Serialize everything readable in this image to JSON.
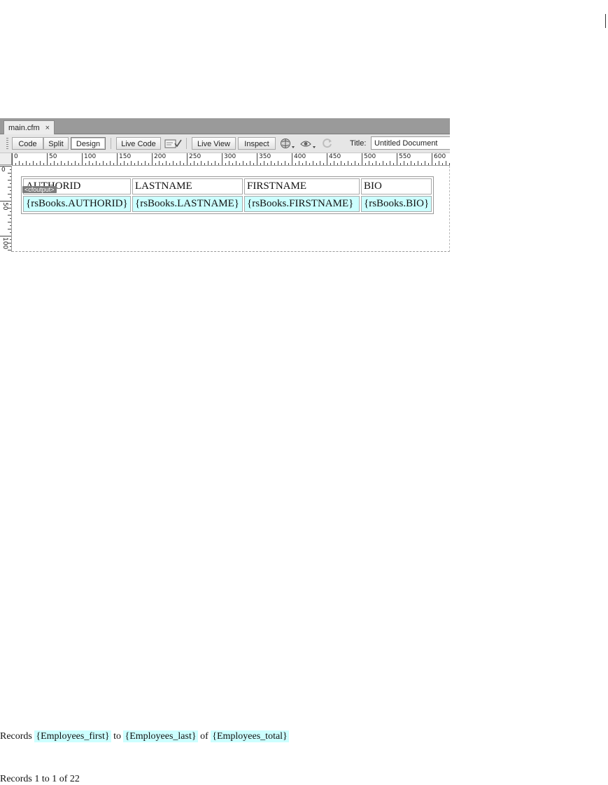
{
  "tab": {
    "filename": "main.cfm",
    "close_glyph": "×"
  },
  "toolbar": {
    "code_label": "Code",
    "split_label": "Split",
    "design_label": "Design",
    "livecode_label": "Live Code",
    "liveview_label": "Live View",
    "inspect_label": "Inspect",
    "title_label": "Title:",
    "title_value": "Untitled Document",
    "icons": [
      "browser-check-icon",
      "globe-preview-icon",
      "visual-aids-icon",
      "refresh-icon"
    ]
  },
  "ruler": {
    "h_labels": [
      "0",
      "50",
      "100",
      "150",
      "200",
      "250",
      "300",
      "350",
      "400",
      "450",
      "500",
      "550",
      "600"
    ],
    "v_labels": [
      "0",
      "50",
      "100"
    ]
  },
  "design_table": {
    "tag": "<cfoutput>",
    "header": [
      "AUTHORID",
      "LASTNAME",
      "FIRSTNAME",
      "BIO"
    ],
    "row": [
      "{rsBooks.AUTHORID}",
      "{rsBooks.LASTNAME}",
      "{rsBooks.FIRSTNAME}",
      "{rsBooks.BIO}"
    ]
  },
  "records_template": {
    "prefix": "Records",
    "first": "{Employees_first}",
    "to": "to",
    "last": "{Employees_last}",
    "of": "of",
    "total": "{Employees_total}"
  },
  "records_rendered": "Records 1 to 1 of 22",
  "colors": {
    "dynamic_highlight": "#ccffff",
    "tab_strip": "#9a9a9a"
  }
}
